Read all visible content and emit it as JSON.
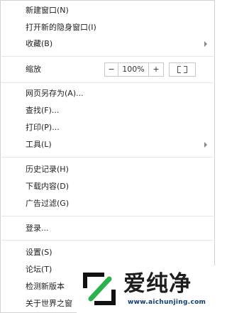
{
  "menu": {
    "new_window": "新建窗口(N)",
    "new_private_window": "打开新的隐身窗口(I)",
    "bookmarks": "收藏(B)",
    "zoom_label": "缩放",
    "zoom_minus": "−",
    "zoom_value": "100%",
    "zoom_plus": "+",
    "save_as": "网页另存为(A)...",
    "find": "查找(F)...",
    "print": "打印(P)...",
    "tools": "工具(L)",
    "history": "历史记录(H)",
    "downloads": "下载内容(D)",
    "ad_filter": "广告过滤(G)",
    "login": "登录...",
    "settings": "设置(S)",
    "forum": "论坛(T)",
    "check_update": "检测新版本",
    "about": "关于世界之窗"
  },
  "watermark": {
    "brand_text": "爱纯净",
    "url": "www.aichunjing.com",
    "accent_color": "#1d1d1d",
    "url_color": "#0c3c78"
  }
}
